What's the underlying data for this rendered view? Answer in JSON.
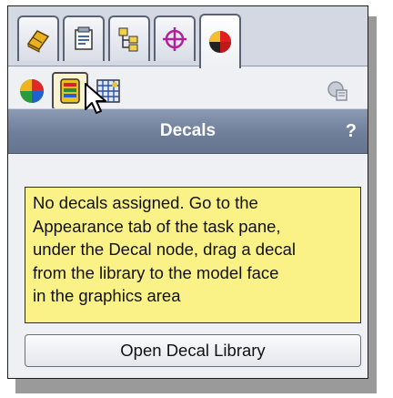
{
  "tabs": [
    {
      "icon": "feature-manager-icon"
    },
    {
      "icon": "property-manager-icon"
    },
    {
      "icon": "configuration-manager-icon"
    },
    {
      "icon": "dimxpert-manager-icon"
    },
    {
      "icon": "display-manager-icon",
      "active": true
    }
  ],
  "toolbar": [
    {
      "icon": "appearances-icon"
    },
    {
      "icon": "decals-icon",
      "pressed": true
    },
    {
      "icon": "scene-icon"
    },
    {
      "icon": "display-options-icon"
    }
  ],
  "header": {
    "title": "Decals",
    "help": "?"
  },
  "message": "No decals assigned. Go to the\nAppearance tab of the task pane,\nunder the Decal node, drag a decal\nfrom the library to the model face\nin the graphics area",
  "button": {
    "label": "Open Decal Library"
  }
}
